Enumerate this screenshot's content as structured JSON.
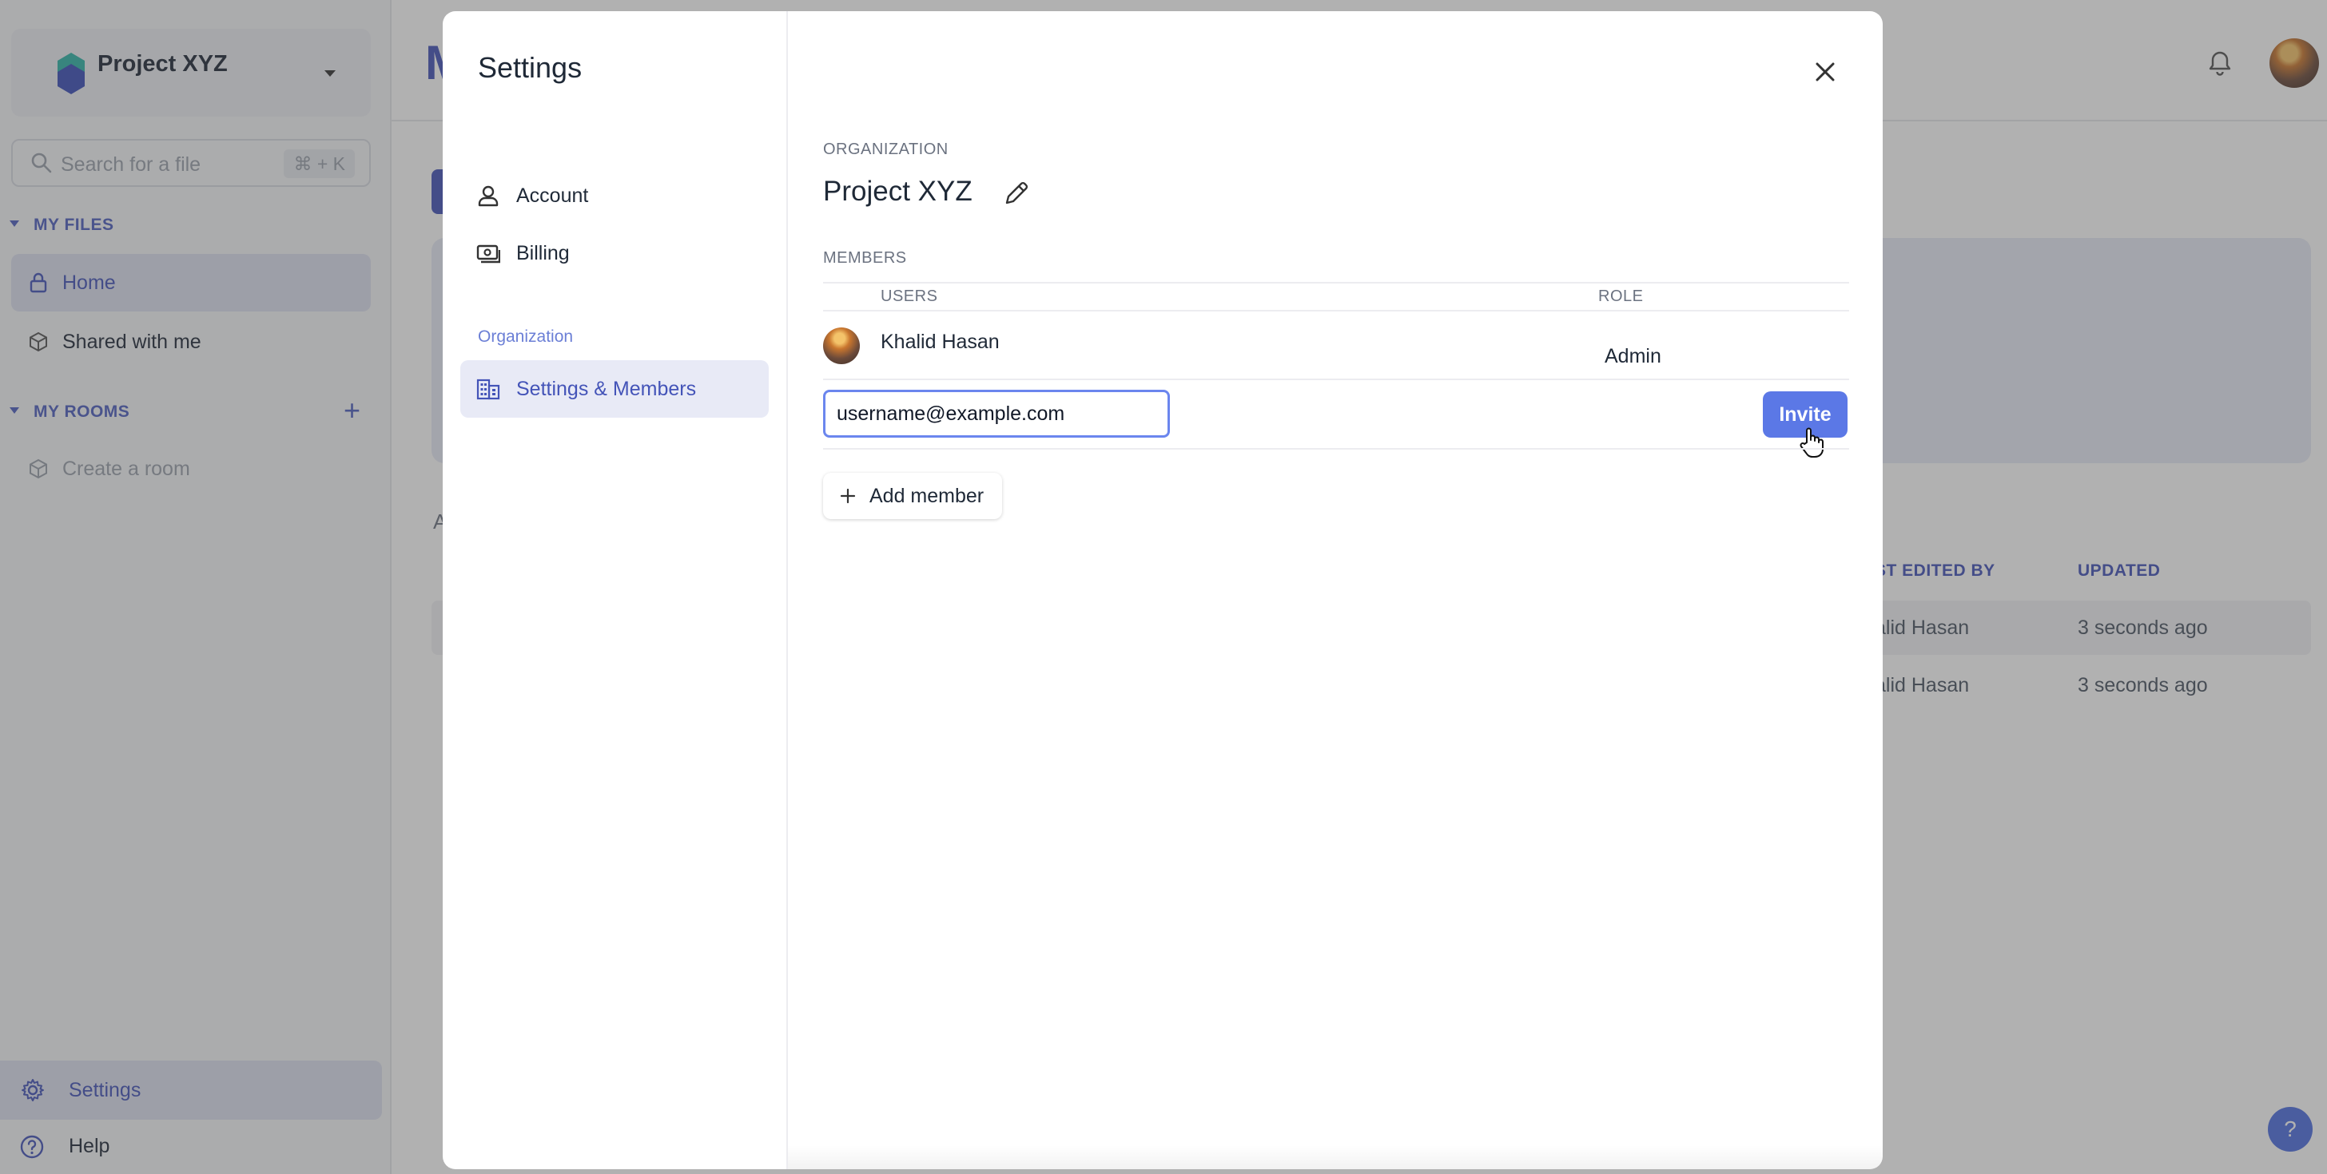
{
  "sidebar": {
    "project_name": "Project XYZ",
    "search_placeholder": "Search for a file",
    "search_shortcut": "⌘ + K",
    "my_files_label": "MY FILES",
    "home_label": "Home",
    "shared_label": "Shared with me",
    "my_rooms_label": "MY ROOMS",
    "add_room_label": "+",
    "create_room_label": "Create a room",
    "settings_label": "Settings",
    "help_label": "Help"
  },
  "main": {
    "page_title_initial": "M",
    "stub_text": "A",
    "columns": {
      "last_edited_by": "ST EDITED BY",
      "updated": "UPDATED"
    },
    "rows": [
      {
        "edited_by": "alid Hasan",
        "updated": "3 seconds ago"
      },
      {
        "edited_by": "alid Hasan",
        "updated": "3 seconds ago"
      }
    ],
    "help_fab": "?"
  },
  "modal": {
    "title": "Settings",
    "menu": {
      "account": "Account",
      "billing": "Billing",
      "group_label": "Organization",
      "settings_members": "Settings & Members"
    },
    "organization_label": "ORGANIZATION",
    "organization_name": "Project XYZ",
    "members_label": "MEMBERS",
    "table_headers": {
      "users": "USERS",
      "role": "ROLE"
    },
    "members": [
      {
        "name": "Khalid Hasan",
        "role": "Admin"
      }
    ],
    "invite_input_value": "username@example.com",
    "invite_button": "Invite",
    "add_member_button": "Add member"
  },
  "colors": {
    "accent": "#4454b8",
    "invite_button": "#5b78e6",
    "input_focus": "#6b86ee"
  }
}
